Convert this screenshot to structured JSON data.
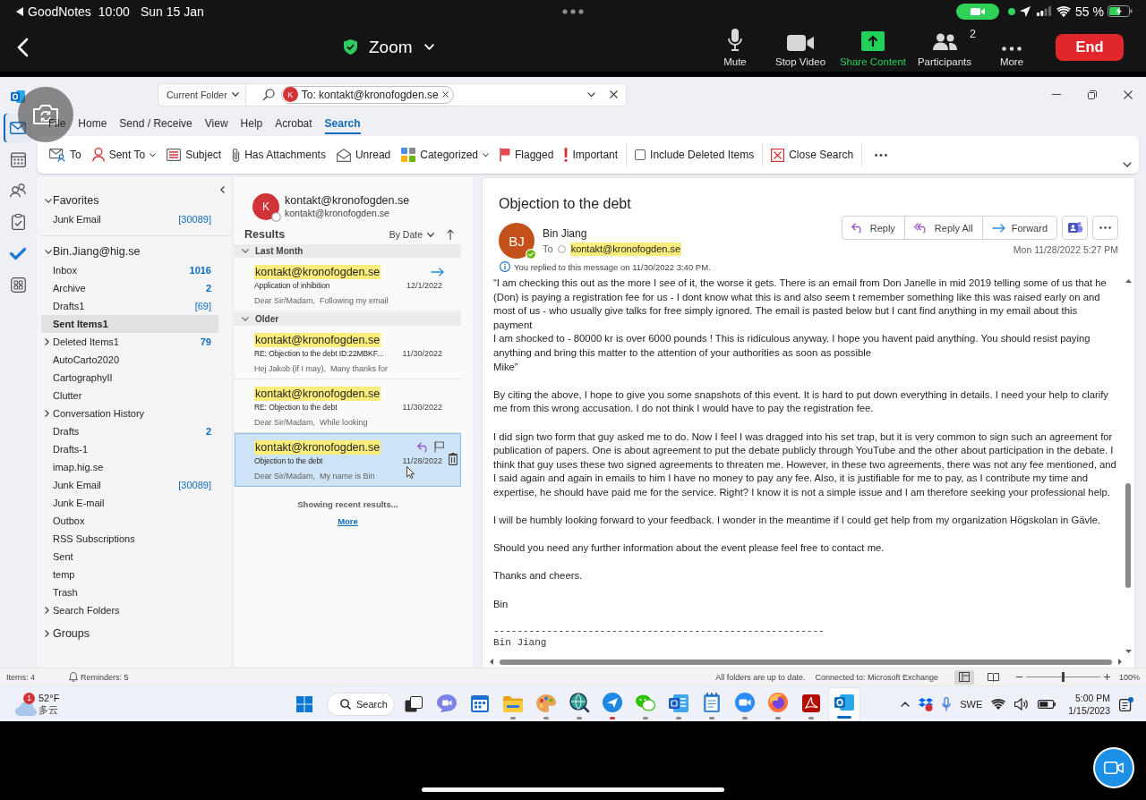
{
  "ios_status_bar": {
    "back_app": "GoodNotes",
    "time": "10:00",
    "date": "Sun 15 Jan",
    "battery": "55 %"
  },
  "zoom_toolbar": {
    "meeting_title": "Zoom",
    "controls": [
      {
        "label": "Mute",
        "highlighted": false
      },
      {
        "label": "Stop Video",
        "highlighted": false
      },
      {
        "label": "Share Content",
        "highlighted": true
      },
      {
        "label": "Participants",
        "highlighted": false,
        "count": "2"
      },
      {
        "label": "More",
        "highlighted": false
      }
    ],
    "end_button": "End"
  },
  "outlook": {
    "search": {
      "scope": "Current Folder",
      "chip_initial": "K",
      "chip_text": "To: kontakt@kronofogden.se"
    },
    "ribbon_tabs": [
      {
        "label": "File",
        "selected": false
      },
      {
        "label": "Home",
        "selected": false
      },
      {
        "label": "Send / Receive",
        "selected": false
      },
      {
        "label": "View",
        "selected": false
      },
      {
        "label": "Help",
        "selected": false
      },
      {
        "label": "Acrobat",
        "selected": false
      },
      {
        "label": "Search",
        "selected": true
      }
    ],
    "ribbon_groups": [
      {
        "commands": [
          {
            "label": "To",
            "kind": "button"
          },
          {
            "label": "Sent To",
            "kind": "dropdown"
          },
          {
            "label": "Subject",
            "kind": "button"
          },
          {
            "label": "Has Attachments",
            "kind": "button"
          },
          {
            "label": "Unread",
            "kind": "button"
          },
          {
            "label": "Categorized",
            "kind": "dropdown"
          },
          {
            "label": "Flagged",
            "kind": "button"
          },
          {
            "label": "Important",
            "kind": "button"
          }
        ]
      },
      {
        "commands": [
          {
            "label": "Include Deleted Items",
            "kind": "checkbox",
            "checked": false
          }
        ]
      },
      {
        "commands": [
          {
            "label": "Close Search",
            "kind": "button"
          }
        ]
      }
    ],
    "app_rail": [
      {
        "selected": true
      },
      {
        "selected": false
      },
      {
        "selected": false
      },
      {
        "selected": false
      },
      {
        "selected": false
      },
      {
        "selected": false
      }
    ],
    "folder_pane": {
      "sections": [
        {
          "label": "Favorites",
          "expanded": true,
          "folders": [
            {
              "name": "Junk Email",
              "count": "[30089]",
              "unread": false,
              "selected": false
            }
          ]
        },
        {
          "label": "Bin.Jiang@hig.se",
          "expanded": true,
          "folders": [
            {
              "name": "Inbox",
              "count": "1016",
              "unread": true,
              "selected": false
            },
            {
              "name": "Archive",
              "count": "2",
              "unread": true,
              "selected": false
            },
            {
              "name": "Drafts1",
              "count": "[69]",
              "unread": false,
              "selected": false
            },
            {
              "name": "Sent Items1",
              "selected": true
            },
            {
              "name": "Deleted Items1",
              "count": "79",
              "unread": true,
              "selected": false,
              "expanded": false
            },
            {
              "name": "AutoCarto2020",
              "selected": false
            },
            {
              "name": "CartographyII",
              "selected": false
            },
            {
              "name": "Clutter",
              "selected": false
            },
            {
              "name": "Conversation History",
              "selected": false,
              "expanded": false
            },
            {
              "name": "Drafts",
              "count": "2",
              "unread": true,
              "selected": false
            },
            {
              "name": "Drafts-1",
              "selected": false
            },
            {
              "name": "imap.hig.se",
              "selected": false
            },
            {
              "name": "Junk Email",
              "count": "[30089]",
              "unread": false,
              "selected": false
            },
            {
              "name": "Junk E-mail",
              "selected": false
            },
            {
              "name": "Outbox",
              "selected": false
            },
            {
              "name": "RSS Subscriptions",
              "selected": false
            },
            {
              "name": "Sent",
              "selected": false
            },
            {
              "name": "temp",
              "selected": false
            },
            {
              "name": "Trash",
              "selected": false
            },
            {
              "name": "Search Folders",
              "selected": false,
              "expanded": false
            }
          ]
        },
        {
          "label": "Groups",
          "expanded": false
        }
      ]
    },
    "message_list": {
      "contact": {
        "initial": "K",
        "name": "kontakt@kronofogden.se",
        "email": "kontakt@kronofogden.se"
      },
      "title": "Results",
      "sort": "By Date",
      "groups": [
        {
          "label": "Last Month",
          "expanded": true,
          "messages": [
            {
              "sender": "kontakt@kronofogden.se",
              "highlighted": true,
              "subject": "Application of inhibition",
              "preview": "Dear Sir/Madam,  Following my email",
              "date": "12/1/2022",
              "forwarded": true,
              "replied": false,
              "selected": false,
              "hovered": false
            }
          ]
        },
        {
          "label": "Older",
          "expanded": true,
          "messages": [
            {
              "sender": "kontakt@kronofogden.se",
              "highlighted": true,
              "subject": "RE: Objection to the debt ID:22MBKF...",
              "preview": "Hej Jakob (if I may),  Many thanks for",
              "date": "11/30/2022",
              "forwarded": false,
              "replied": false,
              "selected": false,
              "hovered": false
            },
            {
              "sender": "kontakt@kronofogden.se",
              "highlighted": true,
              "subject": "RE: Objection to the debt",
              "preview": "Dear Sir/Madam,  While looking",
              "date": "11/30/2022",
              "forwarded": false,
              "replied": false,
              "selected": false,
              "hovered": false
            },
            {
              "sender": "kontakt@kronofogden.se",
              "highlighted": true,
              "subject": "Objection to the debt",
              "preview": "Dear Sir/Madam,  My name is Bin",
              "date": "11/28/2022",
              "forwarded": false,
              "replied": true,
              "selected": true,
              "hovered": true
            }
          ]
        }
      ],
      "footer": "Showing recent results...",
      "more_link": "More"
    },
    "reading_pane": {
      "subject": "Objection to the debt",
      "sender": {
        "initials": "BJ",
        "name": "Bin Jiang",
        "online": true
      },
      "to_label": "To",
      "recipient": "kontakt@kronofogden.se",
      "recipient_highlighted": true,
      "actions": [
        "Reply",
        "Reply All",
        "Forward"
      ],
      "sent": "Mon 11/28/2022 5:27 PM",
      "notice": "You replied to this message on 11/30/2022 3:40 PM.",
      "body": [
        {
          "kind": "text",
          "lines": [
            "“I am checking this out as the more I see of it, the worse it gets. There is an email from Don Janelle in mid 2019 telling some of us that he (Don) is paying a registration fee for us - I dont know what this is and also seem t remember something like this was raised early on and most of us - who usually give talks for free simply ignored. The email is pasted below but I cant find anything in my email about this payment",
            "I am shocked to - 80000 kr is over 6000 pounds ! This is ridiculous anyway. I hope you havent paid anything. You should resist paying anything and bring this matter to the attention of your authorities as soon as possible",
            "Mike”"
          ]
        },
        {
          "kind": "text",
          "lines": [
            "By citing the above, I hope to give you some snapshots of this event. It is hard to put down everything in details. I need your help to clarify me from this wrong accusation. I do not think I would have to pay the registration fee."
          ]
        },
        {
          "kind": "text",
          "lines": [
            "I did sign two form that guy asked me to do. Now I feel I was dragged into his set trap, but it is very common to sign such an agreement for publication of papers. One is about agreement to put the debate publicly through YouTube and the other about participation in the debate. I think that guy uses these two signed agreements to threaten me. However, in these two agreements, there was not any fee mentioned, and I said again and again in emails to him I have no money to pay any fee. Also, it is justifiable for me to pay, as I contribute my time and expertise, he should have paid me for the service. Right? I know it is not a simple issue and I am therefore seeking your professional help."
          ]
        },
        {
          "kind": "text",
          "lines": [
            "I will be humbly looking forward to your feedback. I wonder in the meantime if I could get help from my organization Högskolan in Gävle."
          ]
        },
        {
          "kind": "text",
          "lines": [
            "Should you need any further information about the event please feel free to contact me."
          ]
        },
        {
          "kind": "text",
          "lines": [
            "Thanks and cheers."
          ]
        },
        {
          "kind": "text",
          "lines": [
            "Bin"
          ]
        },
        {
          "kind": "signature",
          "lines": [
            "--------------------------------------------------------",
            "Bin Jiang"
          ]
        }
      ]
    },
    "status_bar": {
      "items": "Items: 4",
      "reminders": "Reminders: 5",
      "sync": "All folders are up to date.",
      "connection": "Connected to: Microsoft Exchange",
      "views": [
        {
          "selected": true
        },
        {
          "selected": false
        }
      ],
      "zoom": {
        "level": 0.5
      },
      "zoom_label": "100%"
    }
  },
  "taskbar": {
    "weather": {
      "temperature": "52°F",
      "condition": "多云",
      "badge": "1"
    },
    "search": "Search",
    "apps": [
      {
        "running": false,
        "selected": false
      },
      {
        "running": false,
        "selected": false
      },
      {
        "running": false,
        "selected": false
      },
      {
        "running": true,
        "selected": false,
        "color": "#8a8a8a"
      },
      {
        "running": true,
        "selected": false,
        "color": "#8a8a8a"
      },
      {
        "running": true,
        "selected": false,
        "color": "#8a8a8a"
      },
      {
        "running": true,
        "selected": false,
        "color": "#d13438"
      },
      {
        "running": true,
        "selected": false,
        "color": "#8a8a8a"
      },
      {
        "running": true,
        "selected": false,
        "color": "#8a8a8a"
      },
      {
        "running": true,
        "selected": false,
        "color": "#8a8a8a"
      },
      {
        "running": true,
        "selected": false,
        "color": "#8a8a8a"
      },
      {
        "running": true,
        "selected": false,
        "color": "#8a8a8a"
      },
      {
        "running": true,
        "selected": false,
        "color": "#8a8a8a"
      },
      {
        "running": true,
        "selected": true,
        "color": "#0067c0"
      }
    ],
    "tray": {
      "language": "SWE",
      "time": "5:00 PM",
      "date": "1/15/2023"
    }
  }
}
